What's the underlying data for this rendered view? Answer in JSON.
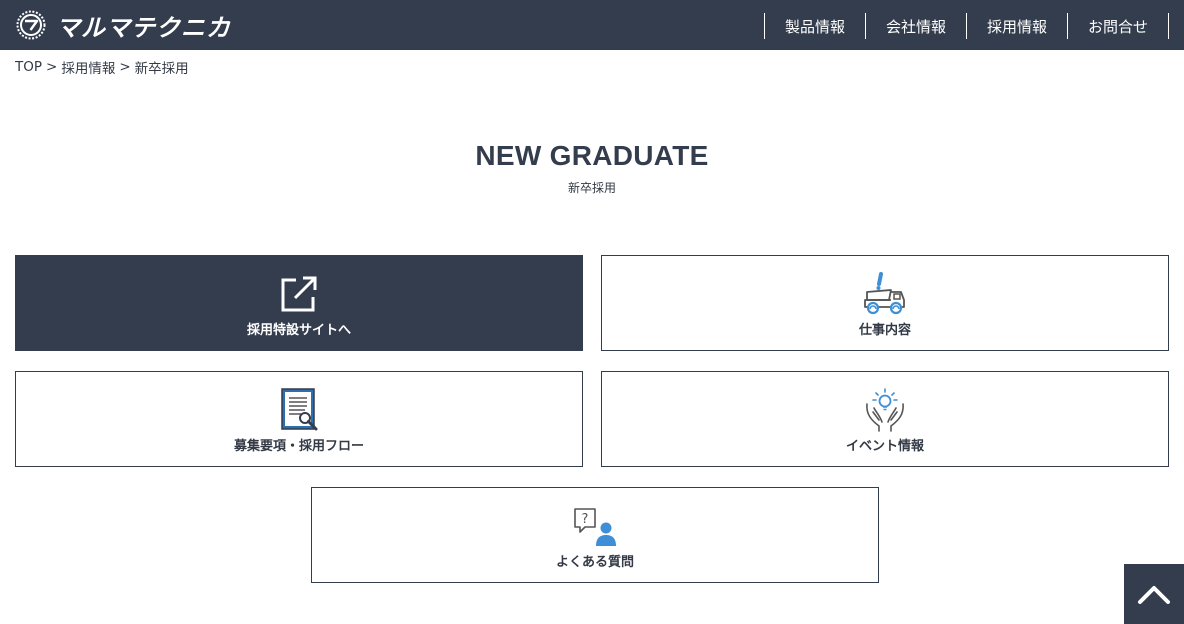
{
  "header": {
    "logo_text": "マルマテクニカ",
    "nav": [
      {
        "label": "製品情報"
      },
      {
        "label": "会社情報"
      },
      {
        "label": "採用情報"
      },
      {
        "label": "お問合せ"
      }
    ]
  },
  "breadcrumb": {
    "items": [
      "TOP",
      "採用情報",
      "新卒採用"
    ],
    "separator": ">"
  },
  "page": {
    "title": "NEW GRADUATE",
    "subtitle": "新卒採用"
  },
  "cards": [
    {
      "label": "採用特設サイトへ",
      "icon": "external-link-icon"
    },
    {
      "label": "仕事内容",
      "icon": "dump-truck-icon"
    },
    {
      "label": "募集要項・採用フロー",
      "icon": "document-magnifier-icon"
    },
    {
      "label": "イベント情報",
      "icon": "hands-lightbulb-icon"
    },
    {
      "label": "よくある質問",
      "icon": "question-person-icon"
    }
  ],
  "colors": {
    "header_bg": "#333d4d",
    "accent_blue": "#3e8fd6",
    "text": "#333a46"
  }
}
